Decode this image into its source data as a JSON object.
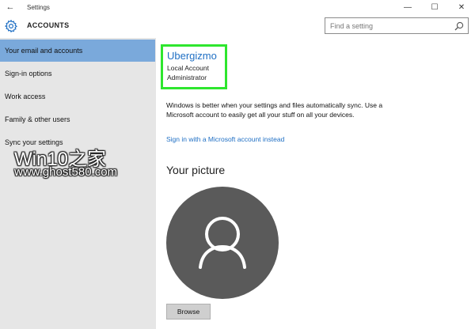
{
  "window": {
    "title": "Settings",
    "back_glyph": "←",
    "minimize_glyph": "—",
    "maximize_glyph": "☐",
    "close_glyph": "✕"
  },
  "header": {
    "title": "ACCOUNTS",
    "icon": "gear-icon"
  },
  "search": {
    "placeholder": "Find a setting",
    "value": "",
    "icon": "search-icon"
  },
  "sidebar": {
    "items": [
      {
        "label": "Your email and accounts",
        "active": true
      },
      {
        "label": "Sign-in options",
        "active": false
      },
      {
        "label": "Work access",
        "active": false
      },
      {
        "label": "Family & other users",
        "active": false
      },
      {
        "label": "Sync your settings",
        "active": false
      }
    ]
  },
  "account": {
    "name": "Ubergizmo",
    "type": "Local Account",
    "role": "Administrator"
  },
  "main": {
    "info_text": "Windows is better when your settings and files automatically sync. Use a Microsoft account to easily get all your stuff on all your devices.",
    "ms_link": "Sign in with a Microsoft account instead",
    "picture_title": "Your picture",
    "browse_label": "Browse"
  },
  "watermark": {
    "line1": "Win10之家",
    "line2": "www.ghost580.com"
  },
  "colors": {
    "accent": "#1f6fc4",
    "sidebar_bg": "#e6e6e6",
    "sidebar_active": "#7aa9db",
    "highlight_box": "#2ee62e",
    "avatar_bg": "#5a5a5a"
  }
}
